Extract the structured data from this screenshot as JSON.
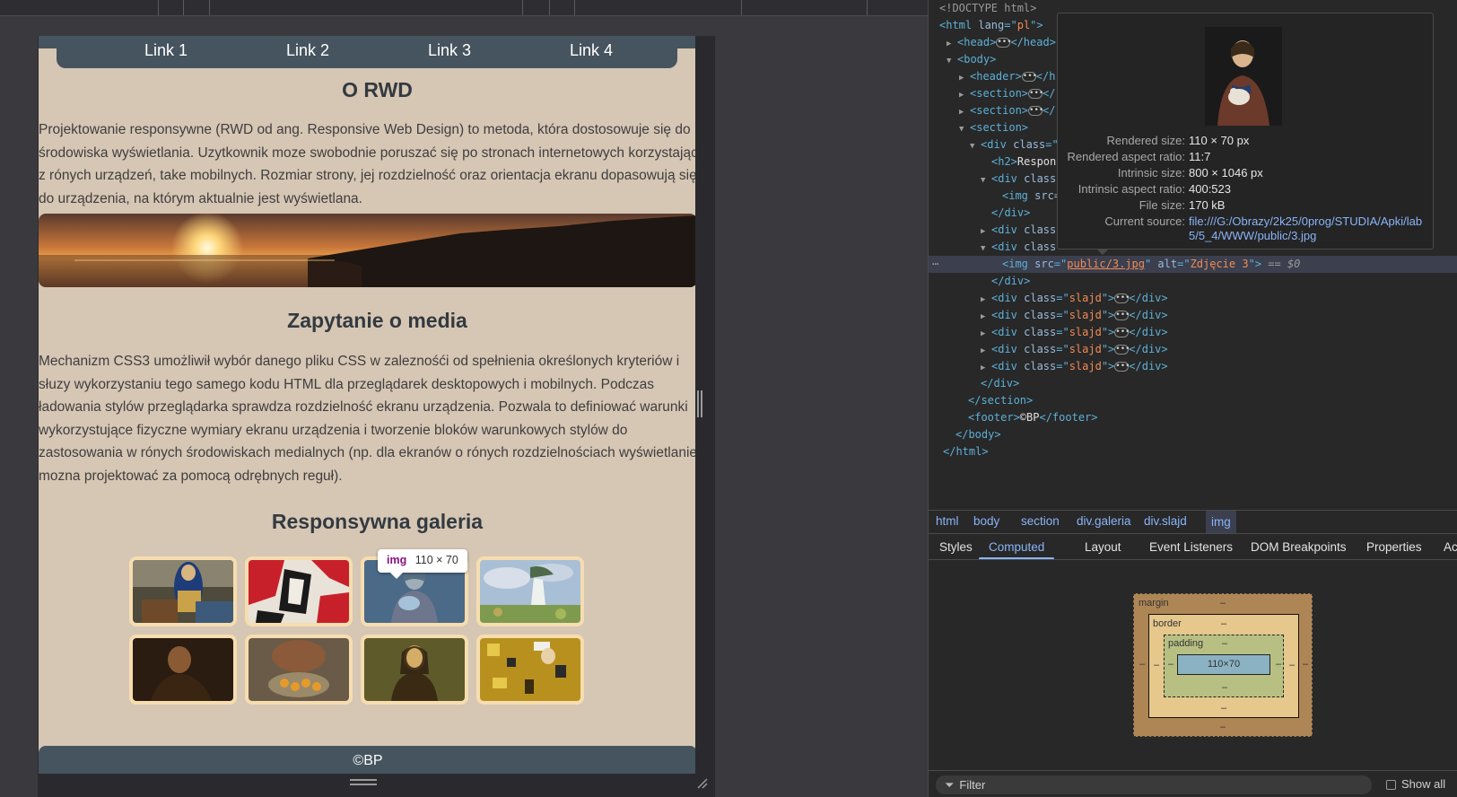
{
  "page": {
    "nav_links": [
      "Link 1",
      "Link 2",
      "Link 3",
      "Link 4"
    ],
    "title": "O RWD",
    "intro_text": "Projektowanie responsywne (RWD od ang. Responsive Web Design) to metoda, która dostosowuje się do środowiska wyświetlania. Uzytkownik moze swobodnie poruszać się po stronach internetowych korzystając z rónych urządzeń, take mobilnych. Rozmiar strony, jej rozdzielność oraz orientacja ekranu dopasowują się do urządzenia, na którym aktualnie jest wyświetlana.",
    "media_heading": "Zapytanie o media",
    "media_text": "Mechanizm CSS3 umożliwił wybór danego pliku CSS w zaleznośći od spełnienia określonych kryteriów i słuzy wykorzystaniu tego samego kodu HTML dla przeglądarek desktopowych i mobilnych. Podczas ładowania stylów przeglądarka sprawdza rozdzielność ekranu urządzenia. Pozwala to definiować warunki wykorzystujące fizyczne wymiary ekranu urządzenia i tworzenie bloków warunkowych stylów do zastosowania w rónych środowiskach medialnych (np. dla ekranów o rónych rozdzielnościach wyświetlanie mozna projektować za pomocą odrębnych reguł).",
    "gallery_heading": "Responsywna galeria",
    "footer": "©BP"
  },
  "hover_tooltip": {
    "tag": "img",
    "size": "110 × 70"
  },
  "devtools": {
    "dom": {
      "doctype": "<!DOCTYPE html>",
      "html_lang": "pl",
      "footer_text": "©BP",
      "selected_img_src": "public/3.jpg",
      "selected_img_alt": "Zdjęcie 3",
      "selected_marker": "== $0",
      "h2_text": "Respon"
    },
    "image_popup": {
      "rendered_size_label": "Rendered size:",
      "rendered_size": "110 × 70 px",
      "rendered_ratio_label": "Rendered aspect ratio:",
      "rendered_ratio": "11:7",
      "intrinsic_size_label": "Intrinsic size:",
      "intrinsic_size": "800 × 1046 px",
      "intrinsic_ratio_label": "Intrinsic aspect ratio:",
      "intrinsic_ratio": "400:523",
      "file_size_label": "File size:",
      "file_size": "170 kB",
      "source_label": "Current source:",
      "source": "file:///G:/Obrazy/2k25/0prog/STUDIA/Apki/lab5/5_4/WWW/public/3.jpg"
    },
    "breadcrumbs": [
      "html",
      "body",
      "section",
      "div.galeria",
      "div.slajd",
      "img"
    ],
    "tabs": [
      "Styles",
      "Computed",
      "Layout",
      "Event Listeners",
      "DOM Breakpoints",
      "Properties",
      "Accessibility"
    ],
    "active_tab": "Computed",
    "box_model": {
      "margin": "margin",
      "border": "border",
      "padding": "padding",
      "content": "110×70",
      "dash": "–"
    },
    "filter_placeholder": "Filter",
    "show_all": "Show all"
  },
  "colors": {
    "page_bg": "#d6c6b4",
    "nav_bg": "#45545e",
    "thumb_border": "#f6ddb0",
    "devtools_bg": "#282828",
    "accent": "#8ab4f8"
  }
}
